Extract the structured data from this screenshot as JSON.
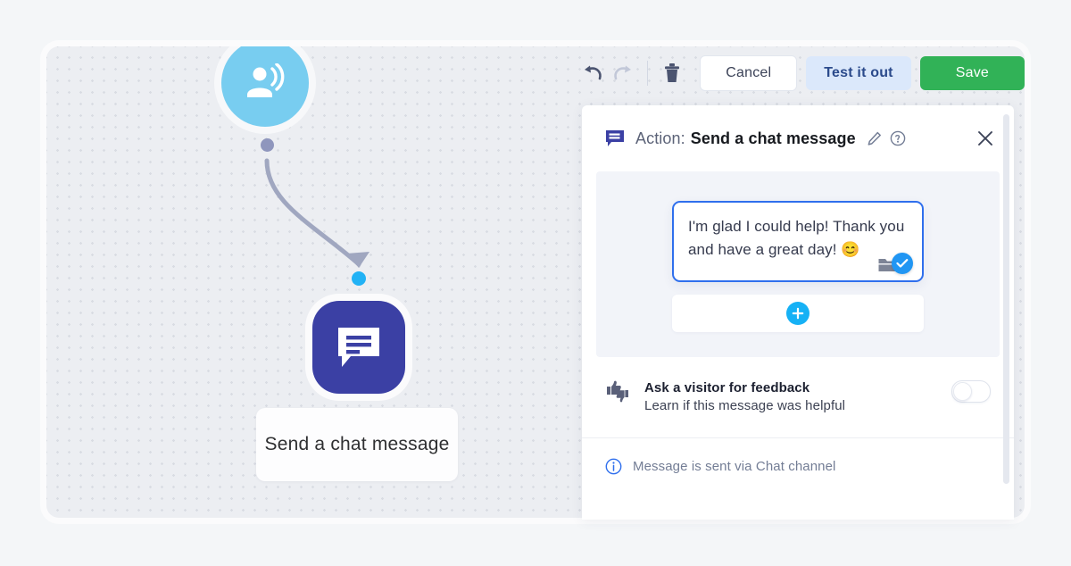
{
  "canvas": {
    "trigger_node": {
      "icon": "visitor-speaking-icon",
      "color": "#78cdf0"
    },
    "action_node": {
      "icon": "chat-message-icon",
      "color": "#3b40a4",
      "label": "Send a chat message"
    },
    "ports": {
      "output_color": "#8f96bd",
      "input_color": "#22b2f5"
    }
  },
  "toolbar": {
    "undo_icon": "undo-icon",
    "redo_icon": "redo-icon",
    "delete_icon": "trash-icon",
    "cancel_label": "Cancel",
    "test_label": "Test it out",
    "save_label": "Save",
    "save_color": "#31b257",
    "test_color": "#dbe8fb"
  },
  "panel": {
    "header": {
      "icon": "chat-message-icon",
      "label": "Action:",
      "title": "Send a chat message",
      "edit_icon": "pencil-icon",
      "help_icon": "question-circle-icon",
      "close_icon": "close-icon"
    },
    "message": {
      "text": "I'm glad I could help! Thank you and have a great day! 😊",
      "attachment_icon": "folder-icon",
      "status_icon": "check-badge-icon",
      "border_color": "#2f6fed"
    },
    "add_button": {
      "icon": "plus-icon",
      "color": "#16b1f5"
    },
    "feedback": {
      "icon": "thumbs-up-down-icon",
      "title": "Ask a visitor for feedback",
      "subtitle": "Learn if this message was helpful",
      "toggle_state": "off"
    },
    "footer": {
      "icon": "info-icon",
      "text": "Message is sent via Chat channel"
    }
  }
}
